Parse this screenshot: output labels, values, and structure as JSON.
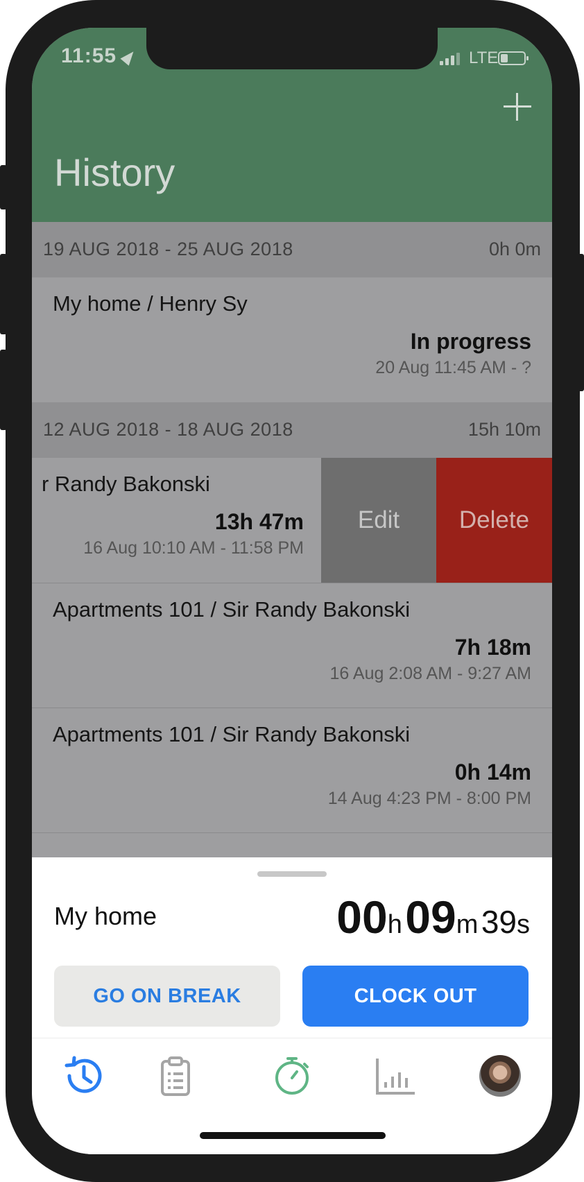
{
  "status_bar": {
    "time": "11:55",
    "network": "LTE"
  },
  "header": {
    "title": "History"
  },
  "weeks": [
    {
      "range": "19 AUG 2018 - 25 AUG 2018",
      "total": "0h 0m",
      "entries": [
        {
          "name": "My home / Henry Sy",
          "duration": "In progress",
          "when": "20 Aug 11:45 AM - ?"
        }
      ]
    },
    {
      "range": "12 AUG 2018 - 18 AUG 2018",
      "total": "15h 10m",
      "entries": [
        {
          "name": "r Randy Bakonski",
          "duration": "13h 47m",
          "when": "16 Aug 10:10 AM - 11:58 PM"
        },
        {
          "name": "Apartments 101 / Sir Randy Bakonski",
          "duration": "7h 18m",
          "when": "16 Aug 2:08 AM - 9:27 AM"
        },
        {
          "name": "Apartments 101 / Sir Randy Bakonski",
          "duration": "0h 14m",
          "when": "14 Aug 4:23 PM - 8:00 PM"
        }
      ]
    }
  ],
  "swipe_actions": {
    "edit": "Edit",
    "delete": "Delete"
  },
  "bottom_sheet": {
    "job": "My home",
    "timer": {
      "hours": "00",
      "h_unit": "h",
      "minutes": "09",
      "m_unit": "m",
      "seconds": "39",
      "s_unit": "s"
    },
    "break_label": "GO ON BREAK",
    "clock_out_label": "CLOCK OUT"
  },
  "tabs": [
    {
      "icon": "history-icon",
      "active": true
    },
    {
      "icon": "clipboard-icon",
      "active": false
    },
    {
      "icon": "stopwatch-icon",
      "active": false
    },
    {
      "icon": "bar-chart-icon",
      "active": false
    },
    {
      "icon": "avatar",
      "active": false
    }
  ],
  "colors": {
    "header_green": "#4b7b5b",
    "accent_blue": "#2a7ef2",
    "delete_red": "#992119",
    "stopwatch_green": "#5fb585"
  }
}
